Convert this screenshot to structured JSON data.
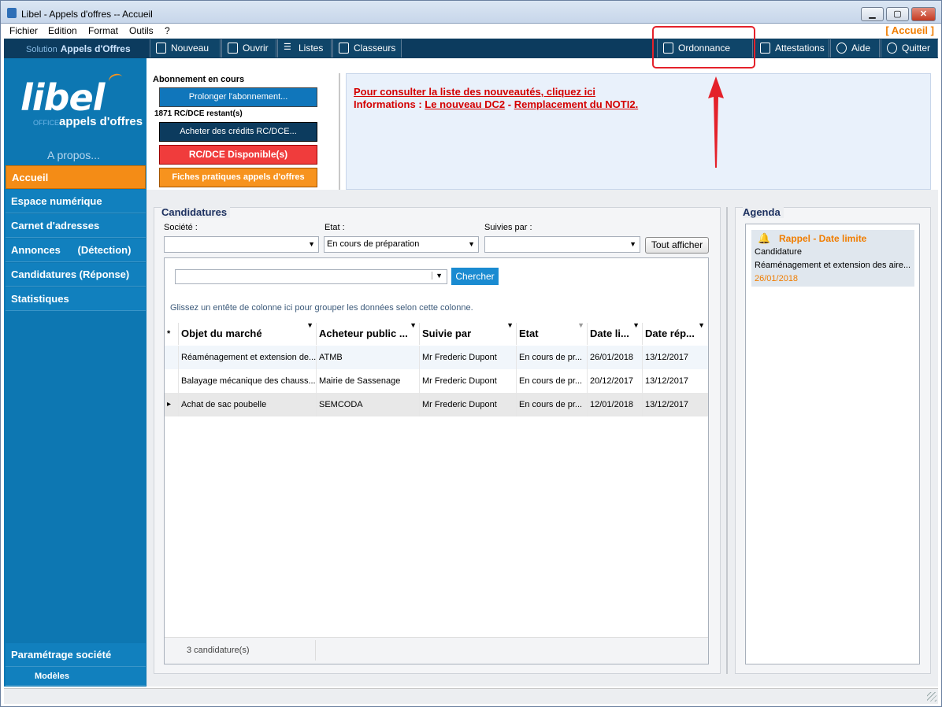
{
  "window": {
    "title": "Libel - Appels d'offres -- Accueil",
    "minimize": "▁",
    "maximize": "▢",
    "close": "✕"
  },
  "menu": {
    "items": [
      "Fichier",
      "Edition",
      "Format",
      "Outils",
      "?"
    ],
    "current_page": "[ Accueil ]"
  },
  "toolbar": {
    "solution_label": "Solution",
    "solution_name": "Appels d'Offres",
    "buttons": [
      "Nouveau",
      "Ouvrir",
      "Listes",
      "Classeurs",
      "Ordonnance MP",
      "Attestations",
      "Aide",
      "Quitter"
    ]
  },
  "sidebar": {
    "logo": "libel",
    "logo_sub_small": "OFFICE",
    "logo_sub": "appels d'offres",
    "apropos": "A propos...",
    "items": [
      "Accueil",
      "Espace numérique",
      "Carnet d'adresses",
      "Annonces      (Détection)",
      "Candidatures (Réponse)",
      "Statistiques"
    ],
    "bottom": [
      "Paramétrage société",
      "Modèles"
    ]
  },
  "subscription": {
    "title": "Abonnement en cours",
    "prolonger": "Prolonger l'abonnement...",
    "remaining": "1871 RC/DCE restant(s)",
    "acheter": "Acheter des crédits RC/DCE...",
    "disponible": "RC/DCE Disponible(s)",
    "fiches": "Fiches pratiques appels d'offres"
  },
  "news": {
    "line1": "Pour consulter la liste des nouveautés, cliquez ici",
    "line2_prefix": "Informations : ",
    "link_dc2": "Le nouveau DC2",
    "sep": " - ",
    "link_noti2": "Remplacement du NOTI2."
  },
  "candidatures": {
    "title": "Candidatures",
    "filters": {
      "societe_label": "Société :",
      "societe_value": "",
      "etat_label": "Etat :",
      "etat_value": "En cours de préparation",
      "suivies_label": "Suivies par :",
      "suivies_value": ""
    },
    "tout_afficher": "Tout afficher",
    "search_value": "",
    "chercher": "Chercher",
    "group_hint": "Glissez un entête de colonne ici pour grouper les données selon cette colonne.",
    "columns": [
      "*",
      "Objet du marché",
      "Acheteur public ...",
      "Suivie par",
      "Etat",
      "Date li...",
      "Date rép..."
    ],
    "rows": [
      {
        "marker": "",
        "objet": "Réaménagement et extension de...",
        "acheteur": "ATMB",
        "suivie": "Mr Frederic Dupont",
        "etat": "En cours de pr...",
        "date_limite": "26/01/2018",
        "date_rep": "13/12/2017"
      },
      {
        "marker": "",
        "objet": "Balayage mécanique des chauss...",
        "acheteur": "Mairie de Sassenage",
        "suivie": "Mr Frederic Dupont",
        "etat": "En cours de pr...",
        "date_limite": "20/12/2017",
        "date_rep": "13/12/2017"
      },
      {
        "marker": "▸",
        "objet": "Achat de sac poubelle",
        "acheteur": "SEMCODA",
        "suivie": "Mr Frederic Dupont",
        "etat": "En cours de pr...",
        "date_limite": "12/01/2018",
        "date_rep": "13/12/2017"
      }
    ],
    "count": "3 candidature(s)"
  },
  "agenda": {
    "title": "Agenda",
    "item": {
      "title": "Rappel - Date limite",
      "type": "Candidature",
      "desc": "Réaménagement et extension des aire...",
      "date": "26/01/2018"
    }
  },
  "colors": {
    "accent_orange": "#f48c16",
    "nav_blue": "#0d77b2",
    "toolbar_dark": "#0c3b5e",
    "highlight_red": "#e4212a"
  }
}
